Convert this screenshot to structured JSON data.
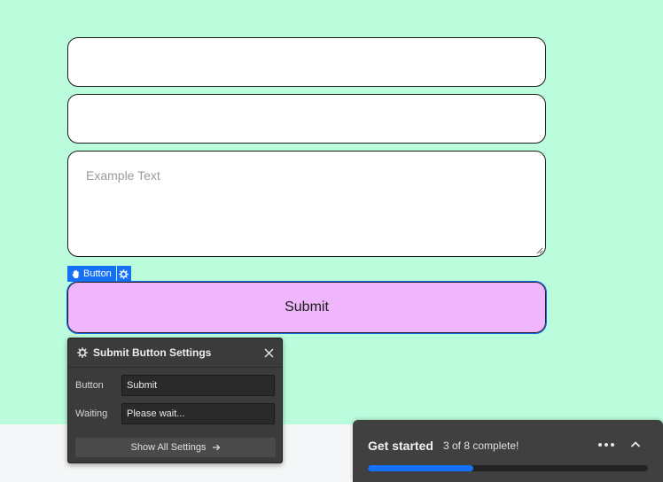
{
  "form": {
    "textarea_placeholder": "Example Text",
    "submit_label": "Submit",
    "background_color": "#bbfcdd",
    "submit_color": "#efb6fc"
  },
  "selection_tag": {
    "label": "Button",
    "icon": "hand-icon",
    "settings_icon": "gear-icon",
    "color": "#1670f5"
  },
  "settings_panel": {
    "title": "Submit Button Settings",
    "rows": [
      {
        "label": "Button",
        "value": "Submit"
      },
      {
        "label": "Waiting",
        "value": "Please wait..."
      }
    ],
    "show_all_label": "Show All Settings"
  },
  "get_started": {
    "title": "Get started",
    "progress_text": "3 of 8 complete!",
    "completed": 3,
    "total": 8
  }
}
